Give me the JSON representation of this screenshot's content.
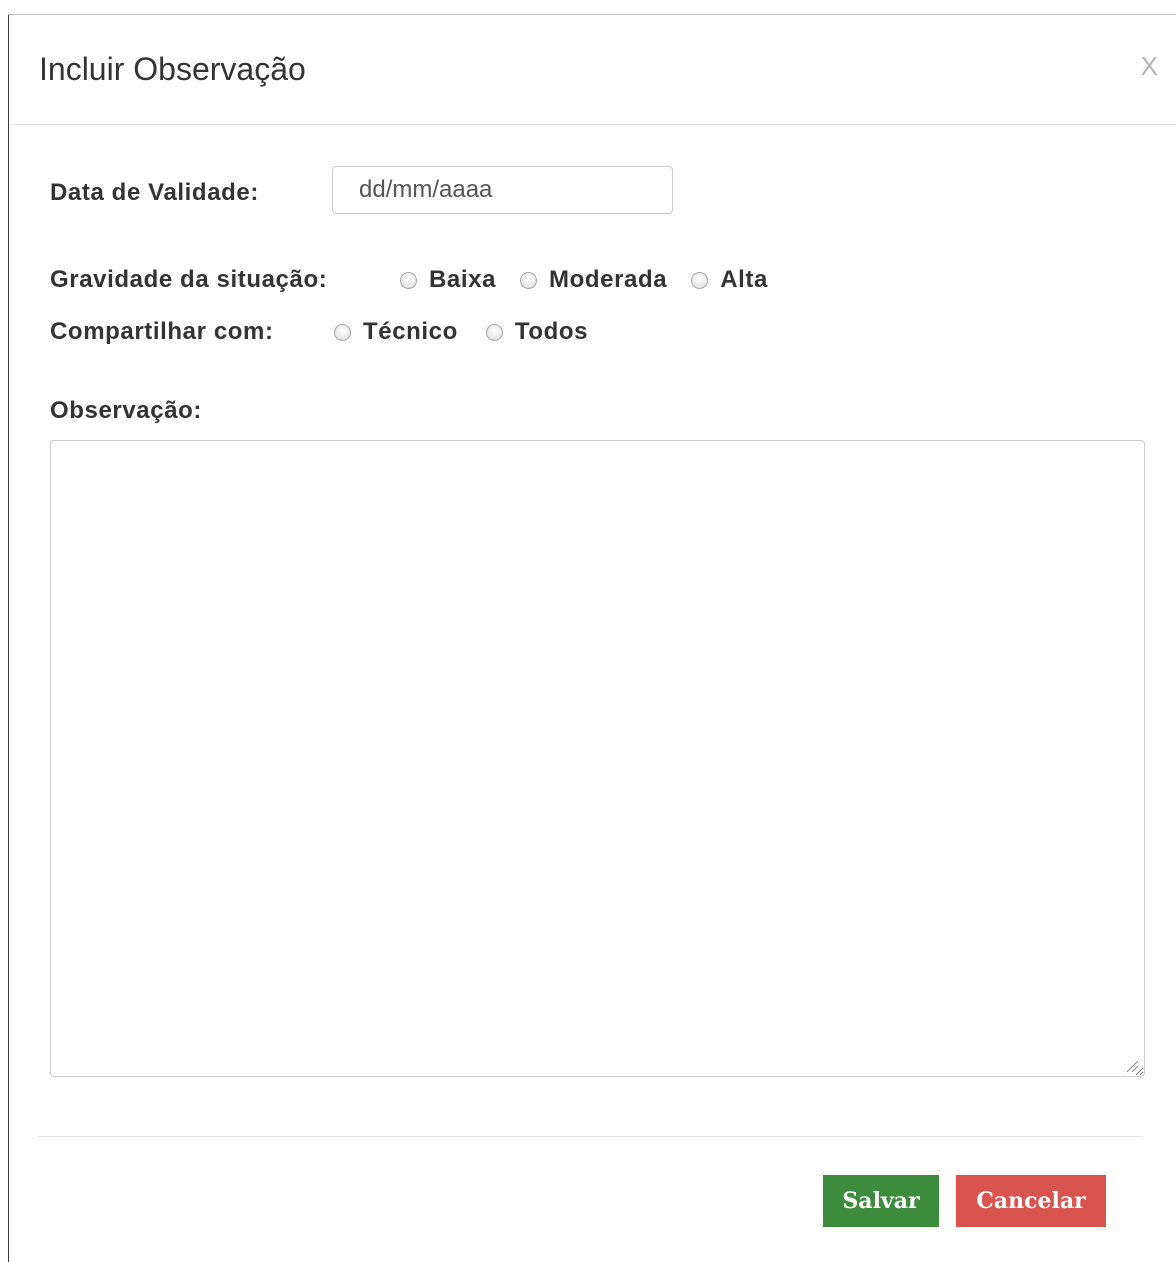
{
  "modal": {
    "title": "Incluir Observação",
    "close_label": "X"
  },
  "form": {
    "validity": {
      "label": "Data de Validade:",
      "placeholder": "dd/mm/aaaa",
      "value": ""
    },
    "severity": {
      "label": "Gravidade da situação:",
      "options": [
        {
          "label": "Baixa",
          "checked": false
        },
        {
          "label": "Moderada",
          "checked": false
        },
        {
          "label": "Alta",
          "checked": false
        }
      ]
    },
    "share": {
      "label": "Compartilhar com:",
      "options": [
        {
          "label": "Técnico",
          "checked": false
        },
        {
          "label": "Todos",
          "checked": false
        }
      ]
    },
    "observation": {
      "label": "Observação:",
      "value": ""
    }
  },
  "footer": {
    "save_label": "Salvar",
    "cancel_label": "Cancelar"
  },
  "colors": {
    "save": "#3d8b3d",
    "cancel": "#d9534f",
    "text": "#333333"
  },
  "icons": {
    "close": "close-icon",
    "resize": "resize-grip-icon"
  }
}
